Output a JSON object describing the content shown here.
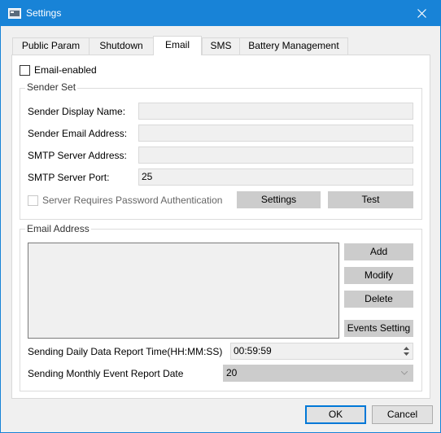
{
  "window": {
    "title": "Settings"
  },
  "tabs": [
    {
      "label": "Public Param"
    },
    {
      "label": "Shutdown"
    },
    {
      "label": "Email",
      "active": true
    },
    {
      "label": "SMS"
    },
    {
      "label": "Battery Management"
    }
  ],
  "email_enabled": {
    "label": "Email-enabled",
    "checked": false
  },
  "sender_set": {
    "title": "Sender Set",
    "display_name_label": "Sender Display Name:",
    "display_name_value": "",
    "email_address_label": "Sender Email Address:",
    "email_address_value": "",
    "smtp_address_label": "SMTP Server Address:",
    "smtp_address_value": "",
    "smtp_port_label": "SMTP Server Port:",
    "smtp_port_value": "25",
    "auth_label": "Server Requires Password Authentication",
    "auth_checked": false,
    "settings_button": "Settings",
    "test_button": "Test"
  },
  "email_address": {
    "title": "Email Address",
    "add_button": "Add",
    "modify_button": "Modify",
    "delete_button": "Delete",
    "events_button": "Events Setting",
    "daily_label": "Sending Daily Data Report Time(HH:MM:SS)",
    "daily_value": "00:59:59",
    "monthly_label": "Sending Monthly Event Report Date",
    "monthly_value": "20"
  },
  "footer": {
    "ok": "OK",
    "cancel": "Cancel"
  },
  "colors": {
    "titlebar": "#1883d7",
    "button_disabled": "#cccccc",
    "field_disabled": "#f0f0f0"
  }
}
